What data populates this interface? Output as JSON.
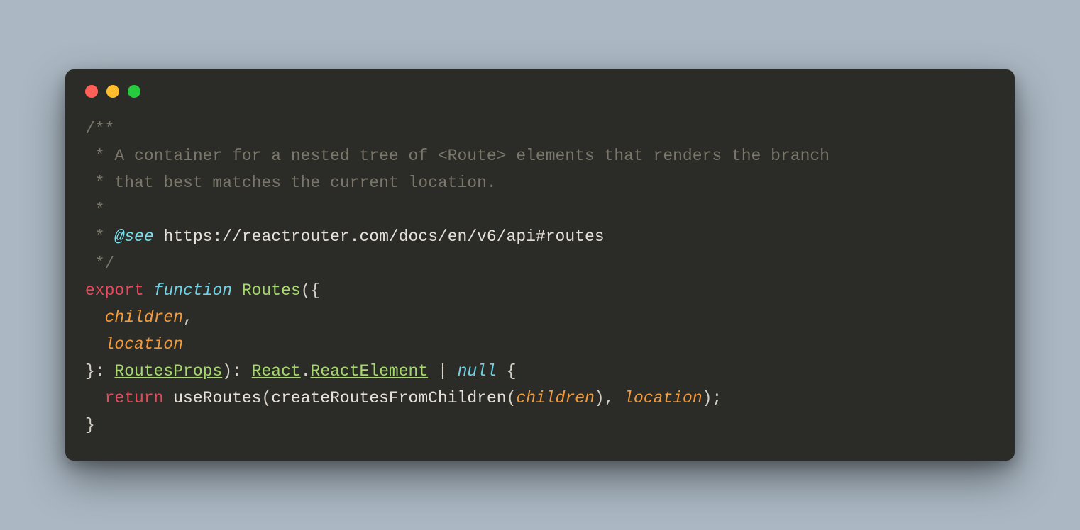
{
  "comment": {
    "l1": "/**",
    "l2": " * A container for a nested tree of <Route> elements that renders the branch",
    "l3": " * that best matches the current location.",
    "l4": " *",
    "l5_pre": " * ",
    "see_tag": "@see",
    "see_url": " https://reactrouter.com/docs/en/v6/api#routes",
    "l6": " */"
  },
  "sig": {
    "export": "export",
    "function": "function",
    "name": "Routes",
    "open": "({",
    "p1": "children",
    "comma": ",",
    "p2": "location",
    "close_destruct": "}: ",
    "type1": "RoutesProps",
    "paren_colon": "): ",
    "type2a": "React",
    "dot": ".",
    "type2b": "ReactElement",
    "pipe": " | ",
    "null": "null",
    "brace_open": " {"
  },
  "body": {
    "indent": "  ",
    "return": "return",
    "sp": " ",
    "call1": "useRoutes",
    "lp": "(",
    "call2": "createRoutesFromChildren",
    "arg1": "children",
    "rp": ")",
    "comma_sp": ", ",
    "arg2": "location",
    "tail": ");"
  },
  "close": "}"
}
